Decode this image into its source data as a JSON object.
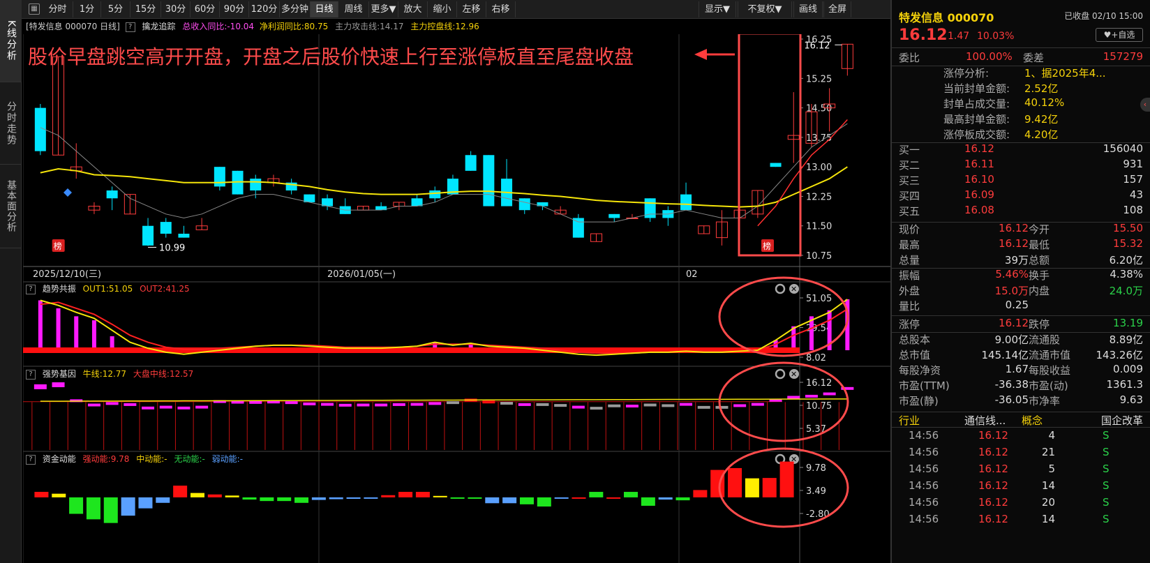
{
  "left_tabs": [
    {
      "label": "K线分析"
    },
    {
      "label": "分时走势"
    },
    {
      "label": "基本面分析"
    }
  ],
  "toolbar": {
    "periods": [
      "分时",
      "1分",
      "5分",
      "15分",
      "30分",
      "60分",
      "90分",
      "120分",
      "多分钟",
      "日线",
      "周线",
      "更多▼"
    ],
    "active_period": "日线",
    "tools": [
      "放大",
      "缩小",
      "左移",
      "右移"
    ],
    "right_tools": [
      "显示▼",
      "不复权▼",
      "画线",
      "全屏"
    ]
  },
  "info_line": {
    "title": "[特发信息 000070 日线]",
    "indicator": "擒龙追踪",
    "rev": "总收入同比:-10.04",
    "profit": "净利润同比:80.75",
    "attack": "主力攻击线:14.17",
    "control": "主力控盘线:12.96"
  },
  "annotation": "股价早盘跳空高开开盘，开盘之后股价快速上行至涨停板直至尾盘收盘",
  "main_chart": {
    "y_ticks": [
      "16.25",
      "15.25",
      "14.50",
      "13.75",
      "13.00",
      "12.25",
      "11.50",
      "10.75"
    ],
    "x_labels": [
      "2025/12/10(三)",
      "2026/01/05(一)",
      "02"
    ],
    "high_label": "16.12",
    "low_label": "10.99",
    "badge": "榜"
  },
  "sub1": {
    "name": "趋势共振",
    "out1": "OUT1:51.05",
    "out2": "OUT2:41.25",
    "ticks": [
      "51.05",
      "29.54",
      "8.02"
    ]
  },
  "sub2": {
    "name": "强势基因",
    "bull": "牛线:12.77",
    "market": "大盘中线:12.57",
    "ticks": [
      "16.12",
      "10.75",
      "5.37"
    ]
  },
  "sub3": {
    "name": "资金动能",
    "strong": "强动能:9.78",
    "mid": "中动能:-",
    "none": "无动能:-",
    "weak": "弱动能:-",
    "ticks": [
      "9.78",
      "3.49",
      "-2.80"
    ]
  },
  "chart_data": {
    "type": "candlestick",
    "candles": [
      [
        14.5,
        13.4,
        14.6,
        13.3
      ],
      [
        13.3,
        15.8,
        15.8,
        13.3
      ],
      [
        12.9,
        13.0,
        13.6,
        12.7
      ],
      [
        11.9,
        12.0,
        12.1,
        11.8
      ],
      [
        12.4,
        12.2,
        12.5,
        11.9
      ],
      [
        11.8,
        12.3,
        12.3,
        11.8
      ],
      [
        11.5,
        11.0,
        11.7,
        10.99
      ],
      [
        11.6,
        11.3,
        11.7,
        11.2
      ],
      [
        11.3,
        11.2,
        11.5,
        11.2
      ],
      [
        11.4,
        11.5,
        11.7,
        11.4
      ],
      [
        13.0,
        12.5,
        13.0,
        12.4
      ],
      [
        12.9,
        12.3,
        12.9,
        12.3
      ],
      [
        12.7,
        12.4,
        12.8,
        12.2
      ],
      [
        12.6,
        12.7,
        12.8,
        12.5
      ],
      [
        12.6,
        12.4,
        12.7,
        12.3
      ],
      [
        12.3,
        12.1,
        12.3,
        12.1
      ],
      [
        12.2,
        12.0,
        12.3,
        11.9
      ],
      [
        12.0,
        11.8,
        12.2,
        11.8
      ],
      [
        11.9,
        12.0,
        12.0,
        11.9
      ],
      [
        12.0,
        11.9,
        12.1,
        11.9
      ],
      [
        12.0,
        12.1,
        12.1,
        11.9
      ],
      [
        12.2,
        12.0,
        12.3,
        12.0
      ],
      [
        12.4,
        12.2,
        12.5,
        12.1
      ],
      [
        12.7,
        12.3,
        12.8,
        12.3
      ],
      [
        13.3,
        12.9,
        13.4,
        12.9
      ],
      [
        13.3,
        12.0,
        13.3,
        12.0
      ],
      [
        12.7,
        12.0,
        13.2,
        12.0
      ],
      [
        12.2,
        11.9,
        12.2,
        11.8
      ],
      [
        12.1,
        12.0,
        12.1,
        11.9
      ],
      [
        11.8,
        11.9,
        12.0,
        11.8
      ],
      [
        11.7,
        11.2,
        11.8,
        11.2
      ],
      [
        11.1,
        11.3,
        11.3,
        11.1
      ],
      [
        11.8,
        11.7,
        11.8,
        11.6
      ],
      [
        11.7,
        11.7,
        11.8,
        11.7
      ],
      [
        12.2,
        11.7,
        12.2,
        11.6
      ],
      [
        11.9,
        11.7,
        12.0,
        11.5
      ],
      [
        12.3,
        11.9,
        12.6,
        11.9
      ],
      [
        11.3,
        11.5,
        11.5,
        11.3
      ],
      [
        11.2,
        11.6,
        11.9,
        11.0
      ],
      [
        11.7,
        11.9,
        12.0,
        11.7
      ],
      [
        11.8,
        12.4,
        12.4,
        11.7
      ],
      [
        13.1,
        13.0,
        13.1,
        13.0
      ],
      [
        13.7,
        13.8,
        14.9,
        13.1
      ],
      [
        13.6,
        14.4,
        14.6,
        13.5
      ],
      [
        14.5,
        14.6,
        15.0,
        13.9
      ],
      [
        15.5,
        16.12,
        16.12,
        15.32
      ]
    ],
    "ma_yellow": [
      12.85,
      12.95,
      12.9,
      12.8,
      12.78,
      12.75,
      12.7,
      12.65,
      12.6,
      12.6,
      12.6,
      12.62,
      12.62,
      12.6,
      12.55,
      12.5,
      12.42,
      12.36,
      12.32,
      12.3,
      12.3,
      12.3,
      12.33,
      12.36,
      12.38,
      12.38,
      12.35,
      12.32,
      12.28,
      12.25,
      12.2,
      12.15,
      12.12,
      12.1,
      12.08,
      12.06,
      12.05,
      12.02,
      12.0,
      11.98,
      12.0,
      12.1,
      12.3,
      12.5,
      12.7,
      13.0
    ],
    "ma_grey": [
      14.0,
      13.8,
      13.4,
      13.0,
      12.6,
      12.2,
      12.0,
      11.8,
      11.7,
      11.8,
      12.0,
      12.2,
      12.3,
      12.3,
      12.2,
      12.1,
      12.0,
      11.9,
      11.9,
      11.9,
      12.0,
      12.0,
      12.1,
      12.3,
      12.3,
      12.3,
      12.2,
      12.1,
      12.0,
      11.8,
      11.6,
      11.6,
      11.6,
      11.7,
      11.8,
      11.8,
      11.9,
      11.8,
      11.7,
      11.7,
      12.0,
      12.5,
      13.0,
      13.5,
      13.8,
      14.1
    ],
    "vol_colors": [],
    "sub1_bars": [
      50,
      42,
      34,
      30,
      14,
      0,
      0,
      0,
      0,
      0,
      0,
      0,
      0,
      0,
      0,
      0,
      0,
      0,
      0,
      0,
      0,
      0,
      8,
      0,
      6,
      0,
      0,
      0,
      0,
      0,
      0,
      0,
      0,
      0,
      0,
      0,
      0,
      0,
      0,
      0,
      0,
      10,
      24,
      34,
      40,
      51.05
    ],
    "sub1_line_yellow": [
      50,
      45,
      38,
      32,
      20,
      8,
      2,
      -2,
      -4,
      -2,
      0,
      2,
      4,
      5,
      5,
      4,
      3,
      2,
      2,
      2,
      3,
      4,
      8,
      5,
      7,
      4,
      3,
      2,
      0,
      -2,
      -4,
      -5,
      -4,
      -3,
      -2,
      -2,
      -1,
      -2,
      -2,
      -1,
      0,
      10,
      22,
      30,
      38,
      51.05
    ],
    "sub1_line_red": [
      46,
      48,
      42,
      36,
      26,
      15,
      8,
      3,
      1,
      1,
      2,
      3,
      4,
      5,
      5,
      5,
      4,
      3,
      3,
      3,
      3,
      4,
      6,
      6,
      6,
      5,
      4,
      3,
      2,
      0,
      -2,
      -3,
      -3,
      -3,
      -2,
      -2,
      -1,
      -1,
      -1,
      -1,
      0,
      6,
      15,
      22,
      30,
      41.25
    ],
    "sub3_bars": [
      1.5,
      1.0,
      -4.5,
      -6.0,
      -7.0,
      -5.0,
      -3.0,
      -1.5,
      3.2,
      1.2,
      0.8,
      0.5,
      -0.6,
      -1.0,
      -1.0,
      -1.5,
      -0.7,
      -0.5,
      -0.4,
      -0.3,
      0.6,
      1.5,
      1.5,
      0.4,
      -0.2,
      -0.2,
      -1.6,
      -1.6,
      -1.9,
      -2.5,
      -0.3,
      -0.2,
      1.5,
      -0.2,
      1.5,
      -2.3,
      -0.6,
      -0.8,
      2.0,
      7.5,
      8.0,
      5.2,
      5.3,
      9.78
    ],
    "sub3_colors": [
      "r",
      "y",
      "g",
      "g",
      "g",
      "b",
      "b",
      "b",
      "r",
      "y",
      "r",
      "y",
      "g",
      "g",
      "g",
      "g",
      "b",
      "b",
      "b",
      "b",
      "r",
      "r",
      "r",
      "y",
      "g",
      "g",
      "b",
      "b",
      "g",
      "g",
      "b",
      "r",
      "g",
      "r",
      "g",
      "g",
      "b",
      "g",
      "r",
      "r",
      "r",
      "y",
      "r",
      "r"
    ]
  },
  "right_panel": {
    "stock_name": "特发信息 000070",
    "status": "已收盘 02/10 15:00",
    "price": "16.12",
    "change": "1.47",
    "pct": "10.03%",
    "add_btn": "♥+自选",
    "weibi_label": "委比",
    "weibi": "100.00%",
    "weicha_label": "委差",
    "weicha": "157279",
    "zt_rows": [
      {
        "label": "涨停分析:",
        "value": "1、据2025年4..."
      },
      {
        "label": "当前封单金额:",
        "value": "2.52亿"
      },
      {
        "label": "封单占成交量:",
        "value": "40.12%"
      },
      {
        "label": "最高封单金额:",
        "value": "9.42亿"
      },
      {
        "label": "涨停板成交额:",
        "value": "4.20亿"
      }
    ],
    "bids": [
      {
        "label": "买一",
        "price": "16.12",
        "vol": "156040"
      },
      {
        "label": "买二",
        "price": "16.11",
        "vol": "931"
      },
      {
        "label": "买三",
        "price": "16.10",
        "vol": "157"
      },
      {
        "label": "买四",
        "price": "16.09",
        "vol": "43"
      },
      {
        "label": "买五",
        "price": "16.08",
        "vol": "108"
      }
    ],
    "stats1": [
      {
        "l1": "现价",
        "v1": "16.12",
        "c1": "red",
        "l2": "今开",
        "v2": "15.50",
        "c2": "red"
      },
      {
        "l1": "最高",
        "v1": "16.12",
        "c1": "red",
        "l2": "最低",
        "v2": "15.32",
        "c2": "red"
      },
      {
        "l1": "总量",
        "v1": "39万",
        "c1": "white",
        "l2": "总额",
        "v2": "6.20亿",
        "c2": "white"
      }
    ],
    "stats2": [
      {
        "l1": "振幅",
        "v1": "5.46%",
        "c1": "red",
        "l2": "换手",
        "v2": "4.38%",
        "c2": "white"
      },
      {
        "l1": "外盘",
        "v1": "15.0万",
        "c1": "red",
        "l2": "内盘",
        "v2": "24.0万",
        "c2": "green"
      },
      {
        "l1": "量比",
        "v1": "0.25",
        "c1": "white",
        "l2": "",
        "v2": "",
        "c2": "white"
      }
    ],
    "stats3": [
      {
        "l1": "涨停",
        "v1": "16.12",
        "c1": "red",
        "l2": "跌停",
        "v2": "13.19",
        "c2": "green"
      }
    ],
    "stats4": [
      {
        "l1": "总股本",
        "v1": "9.00亿",
        "c1": "white",
        "l2": "流通股",
        "v2": "8.89亿",
        "c2": "white"
      },
      {
        "l1": "总市值",
        "v1": "145.14亿",
        "c1": "white",
        "l2": "流通市值",
        "v2": "143.26亿",
        "c2": "white"
      },
      {
        "l1": "每股净资",
        "v1": "1.67",
        "c1": "white",
        "l2": "每股收益",
        "v2": "0.009",
        "c2": "white"
      },
      {
        "l1": "市盈(TTM)",
        "v1": "-36.38",
        "c1": "white",
        "l2": "市盈(动)",
        "v2": "1361.3",
        "c2": "white"
      },
      {
        "l1": "市盈(静)",
        "v1": "-36.05",
        "c1": "white",
        "l2": "市净率",
        "v2": "9.63",
        "c2": "white"
      }
    ],
    "industry": {
      "l1": "行业",
      "v1": "通信线...",
      "l2": "概念",
      "v2": "国企改革"
    },
    "ticks": [
      {
        "t": "14:56",
        "p": "16.12",
        "v": "4",
        "s": "S"
      },
      {
        "t": "14:56",
        "p": "16.12",
        "v": "21",
        "s": "S"
      },
      {
        "t": "14:56",
        "p": "16.12",
        "v": "5",
        "s": "S"
      },
      {
        "t": "14:56",
        "p": "16.12",
        "v": "14",
        "s": "S"
      },
      {
        "t": "14:56",
        "p": "16.12",
        "v": "20",
        "s": "S"
      },
      {
        "t": "14:56",
        "p": "16.12",
        "v": "14",
        "s": "S"
      }
    ]
  }
}
